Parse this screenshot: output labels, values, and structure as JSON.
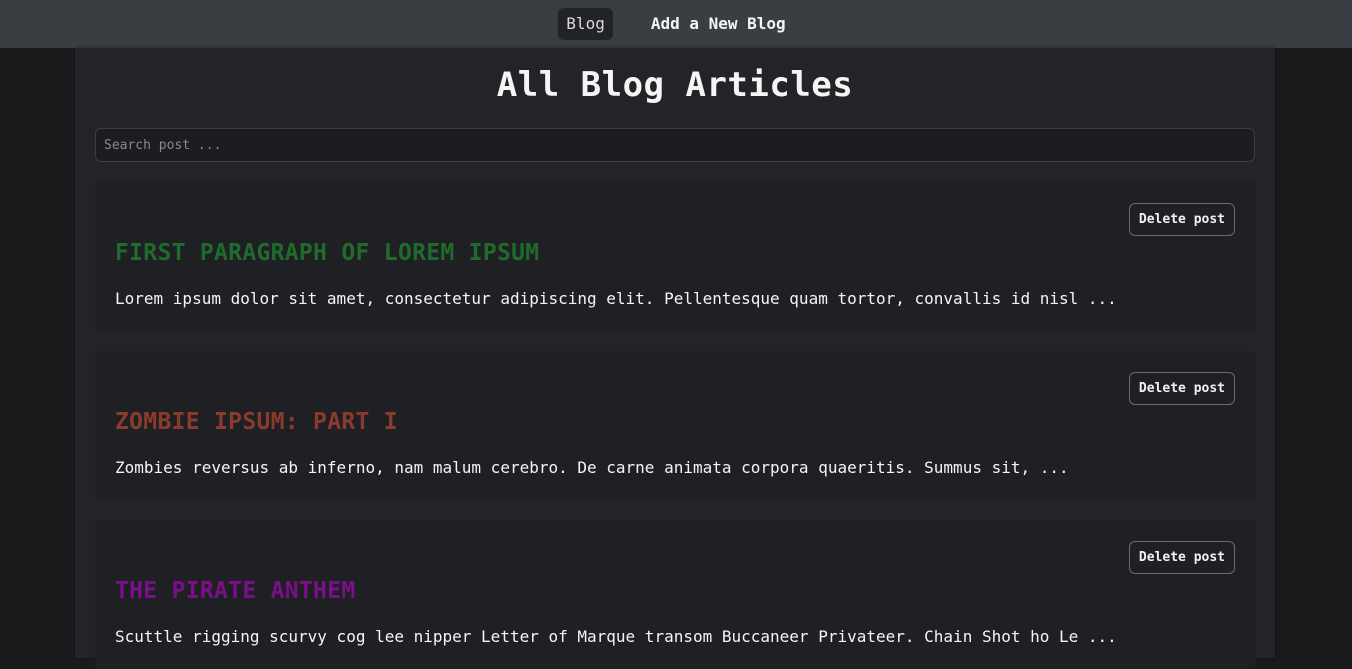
{
  "nav": {
    "items": [
      {
        "label": "Blog",
        "active": true
      },
      {
        "label": "Add a New Blog",
        "active": false
      }
    ]
  },
  "main": {
    "title": "All Blog Articles",
    "search": {
      "placeholder": "Search post ...",
      "value": ""
    },
    "delete_label": "Delete post",
    "posts": [
      {
        "title": "FIRST PARAGRAPH OF LOREM IPSUM",
        "title_color": "#1f6b2c",
        "excerpt": "Lorem ipsum dolor sit amet, consectetur adipiscing elit. Pellentesque quam tortor, convallis id nisl ..."
      },
      {
        "title": "ZOMBIE IPSUM: PART I",
        "title_color": "#8b3a2e",
        "excerpt": "Zombies reversus ab inferno, nam malum cerebro. De carne animata corpora quaeritis. Summus sit,  ..."
      },
      {
        "title": "THE PIRATE ANTHEM",
        "title_color": "#7a0f8a",
        "excerpt": "Scuttle rigging scurvy cog lee nipper Letter of Marque transom Buccaneer Privateer. Chain Shot ho Le ..."
      }
    ]
  }
}
